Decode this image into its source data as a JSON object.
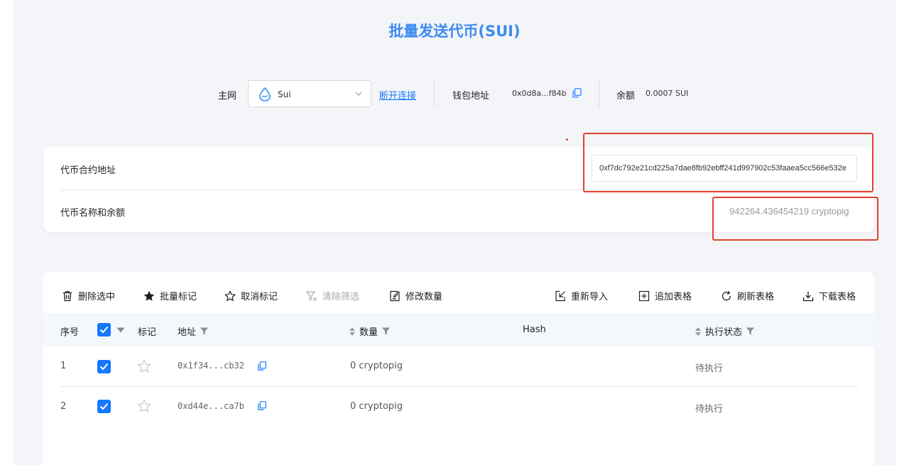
{
  "title": "批量发送代币(SUI)",
  "network": {
    "label": "主网",
    "selected": "Sui",
    "disconnect_label": "断开连接",
    "wallet_label": "钱包地址",
    "wallet_address": "0x0d8a...f84b",
    "balance_label": "余额",
    "balance_value": "0.0007 SUI"
  },
  "token": {
    "contract_label": "代币合约地址",
    "contract_address": "0xf7dc792e21cd225a7dae8fb92ebff241d997902c53faaea5cc566e532e",
    "name_balance_label": "代币名称和余额",
    "name_balance_value": "942264.436454219 cryptopig"
  },
  "toolbar": {
    "delete_selected": "删除选中",
    "batch_mark": "批量标记",
    "cancel_mark": "取消标记",
    "clear_filter": "清除筛选",
    "edit_amount": "修改数量",
    "reimport": "重新导入",
    "append_table": "追加表格",
    "refresh_table": "刷新表格",
    "download_table": "下载表格"
  },
  "table": {
    "headers": {
      "index": "序号",
      "mark": "标记",
      "address": "地址",
      "amount": "数量",
      "hash": "Hash",
      "status": "执行状态"
    },
    "rows": [
      {
        "index": "1",
        "address": "0x1f34...cb32",
        "amount": "0 cryptopig",
        "hash": "",
        "status": "待执行",
        "checked": true,
        "marked": false
      },
      {
        "index": "2",
        "address": "0xd44e...ca7b",
        "amount": "0 cryptopig",
        "hash": "",
        "status": "待执行",
        "checked": true,
        "marked": false
      }
    ]
  },
  "colors": {
    "accent": "#1677ff",
    "title": "#3d8bf0",
    "highlight": "#e0412c"
  }
}
